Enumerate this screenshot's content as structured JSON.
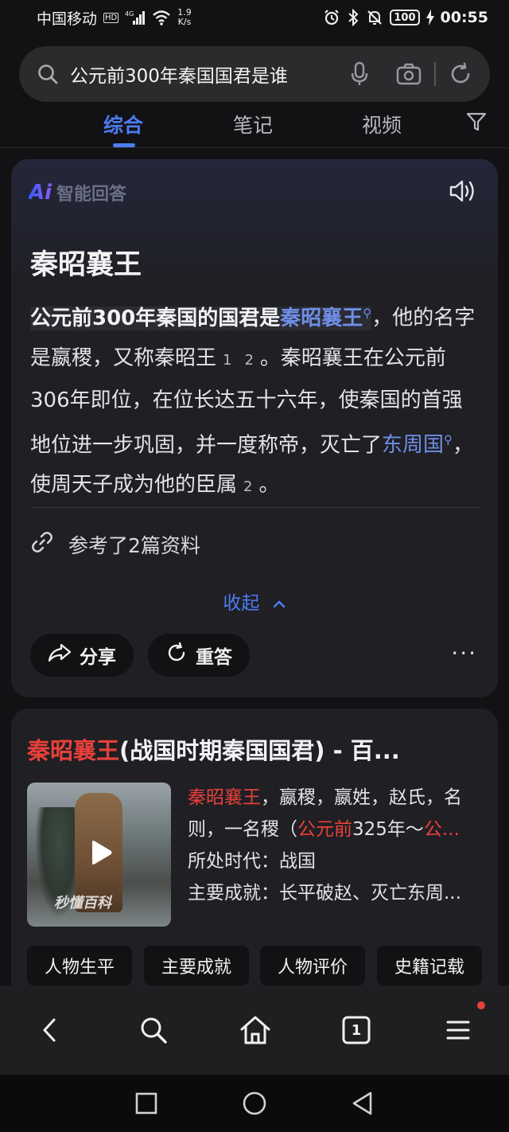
{
  "status_bar": {
    "carrier": "中国移动",
    "hd": "HD",
    "network": "4G",
    "speed_value": "1.9",
    "speed_unit": "K/s",
    "battery": "100",
    "time": "00:55"
  },
  "search": {
    "query": "公元前300年秦国国君是谁",
    "icons": [
      "search-icon",
      "mic-icon",
      "camera-icon",
      "refresh-icon"
    ]
  },
  "tabs": [
    {
      "label": "综合",
      "active": true
    },
    {
      "label": "笔记",
      "active": false
    },
    {
      "label": "视频",
      "active": false
    }
  ],
  "ai_answer": {
    "logo_mark": "Ai",
    "logo_text": "智能回答",
    "title": "秦昭襄王",
    "body": {
      "p1_highlight": "公元前300年秦国的国君是",
      "p1_link": "秦昭襄王",
      "p1_rest": "，他的名字是嬴稷，又称秦昭王",
      "ref1": "1",
      "ref2": "2",
      "p2": "。秦昭襄王在公元前306年即位，在位长达五十六年，使秦国的首强地位进一步巩固，并一度称帝，灭亡了",
      "p2_link": "东周国",
      "p3": "，使周天子成为他的臣属",
      "ref3": "2",
      "p3_end": "。"
    },
    "references": "参考了2篇资料",
    "collapse": "收起",
    "share": "分享",
    "regenerate": "重答",
    "more": "···"
  },
  "result": {
    "title_red": "秦昭襄王",
    "title_rest": "(战国时期秦国国君) - 百...",
    "thumb_watermark": "秒懂百科",
    "line1_red": "秦昭襄王",
    "line1_rest": "，嬴稷，嬴姓，赵氏，名",
    "line2_a": "则，一名稷（",
    "line2_red": "公元前",
    "line2_b": "325年～",
    "line2_red2": "公...",
    "line3": "所处时代：战国",
    "line4": "主要成就：长平破赵、灭亡东周...",
    "chips": [
      "人物生平",
      "主要成就",
      "人物评价",
      "史籍记载"
    ]
  },
  "bottom_nav": {
    "tab_count": "1"
  },
  "colors": {
    "accent": "#4d7df3",
    "red": "#e8403a",
    "background": "#121214",
    "card": "#1f1f24"
  }
}
